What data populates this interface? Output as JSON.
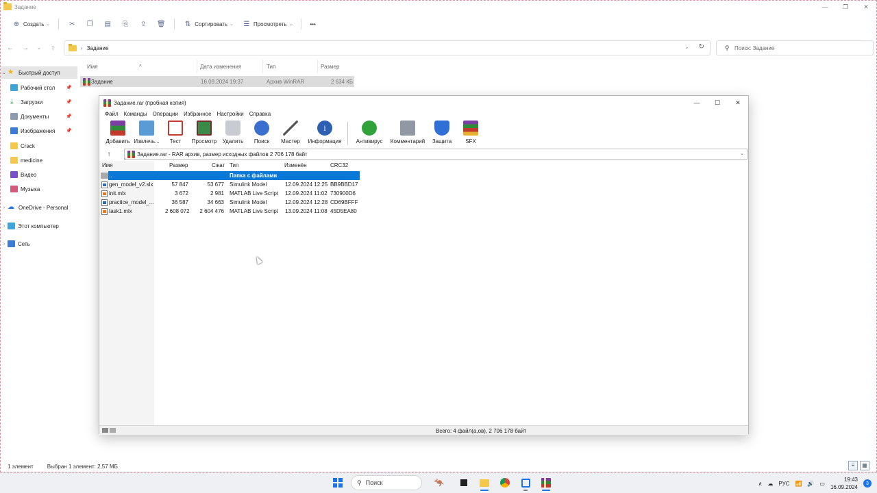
{
  "explorer": {
    "title": "Задание",
    "toolbar": {
      "create": "Создать",
      "sort": "Сортировать",
      "view": "Просмотреть",
      "more": "•••"
    },
    "address": {
      "folder": "Задание",
      "search_placeholder": "Поиск: Задание"
    },
    "nav": {
      "quick_access": "Быстрый доступ",
      "items": [
        "Рабочий стол",
        "Загрузки",
        "Документы",
        "Изображения",
        "Crack",
        "medicine",
        "Видео",
        "Музыка"
      ],
      "onedrive": "OneDrive - Personal",
      "this_pc": "Этот компьютер",
      "network": "Сеть"
    },
    "list": {
      "columns": [
        "Имя",
        "Дата изменения",
        "Тип",
        "Размер"
      ],
      "row": {
        "name": "Задание",
        "date": "16.09.2024 19:37",
        "type": "Архив WinRAR",
        "size": "2 634 КБ"
      }
    },
    "status": {
      "count": "1 элемент",
      "selected": "Выбран 1 элемент: 2,57 МБ"
    }
  },
  "winrar": {
    "title": "Задание.rar (пробная копия)",
    "menu": [
      "Файл",
      "Команды",
      "Операции",
      "Избранное",
      "Настройки",
      "Справка"
    ],
    "tools": [
      "Добавить",
      "Извлечь...",
      "Тест",
      "Просмотр",
      "Удалить",
      "Поиск",
      "Мастер",
      "Информация",
      "Антивирус",
      "Комментарий",
      "Защита",
      "SFX"
    ],
    "path": "Задание.rar - RAR архив, размер исходных файлов 2 706 178 байт",
    "columns": [
      "Имя",
      "Размер",
      "Сжат",
      "Тип",
      "Изменён",
      "CRC32"
    ],
    "parent_row": {
      "name": "..",
      "type": "Папка с файлами"
    },
    "files": [
      {
        "name": "gen_model_v2.slx",
        "size": "57 847",
        "packed": "53 677",
        "type": "Simulink Model",
        "modified": "12.09.2024 12:25",
        "crc": "BB9BBD17",
        "kind": "slx"
      },
      {
        "name": "init.mlx",
        "size": "3 672",
        "packed": "2 981",
        "type": "MATLAB Live Script",
        "modified": "12.09.2024 11:02",
        "crc": "730900D6",
        "kind": "mlx"
      },
      {
        "name": "practice_model_...",
        "size": "36 587",
        "packed": "34 663",
        "type": "Simulink Model",
        "modified": "12.09.2024 12:28",
        "crc": "CD69BFFF",
        "kind": "slx"
      },
      {
        "name": "task1.mlx",
        "size": "2 608 072",
        "packed": "2 604 476",
        "type": "MATLAB Live Script",
        "modified": "13.09.2024 11:08",
        "crc": "45D5EA80",
        "kind": "mlx"
      }
    ],
    "status": "Всего: 4 файл(а,ов), 2 706 178 байт"
  },
  "taskbar": {
    "search": "Поиск",
    "lang": "РУС",
    "time": "19:43",
    "date": "16.09.2024",
    "notifications": "3"
  }
}
